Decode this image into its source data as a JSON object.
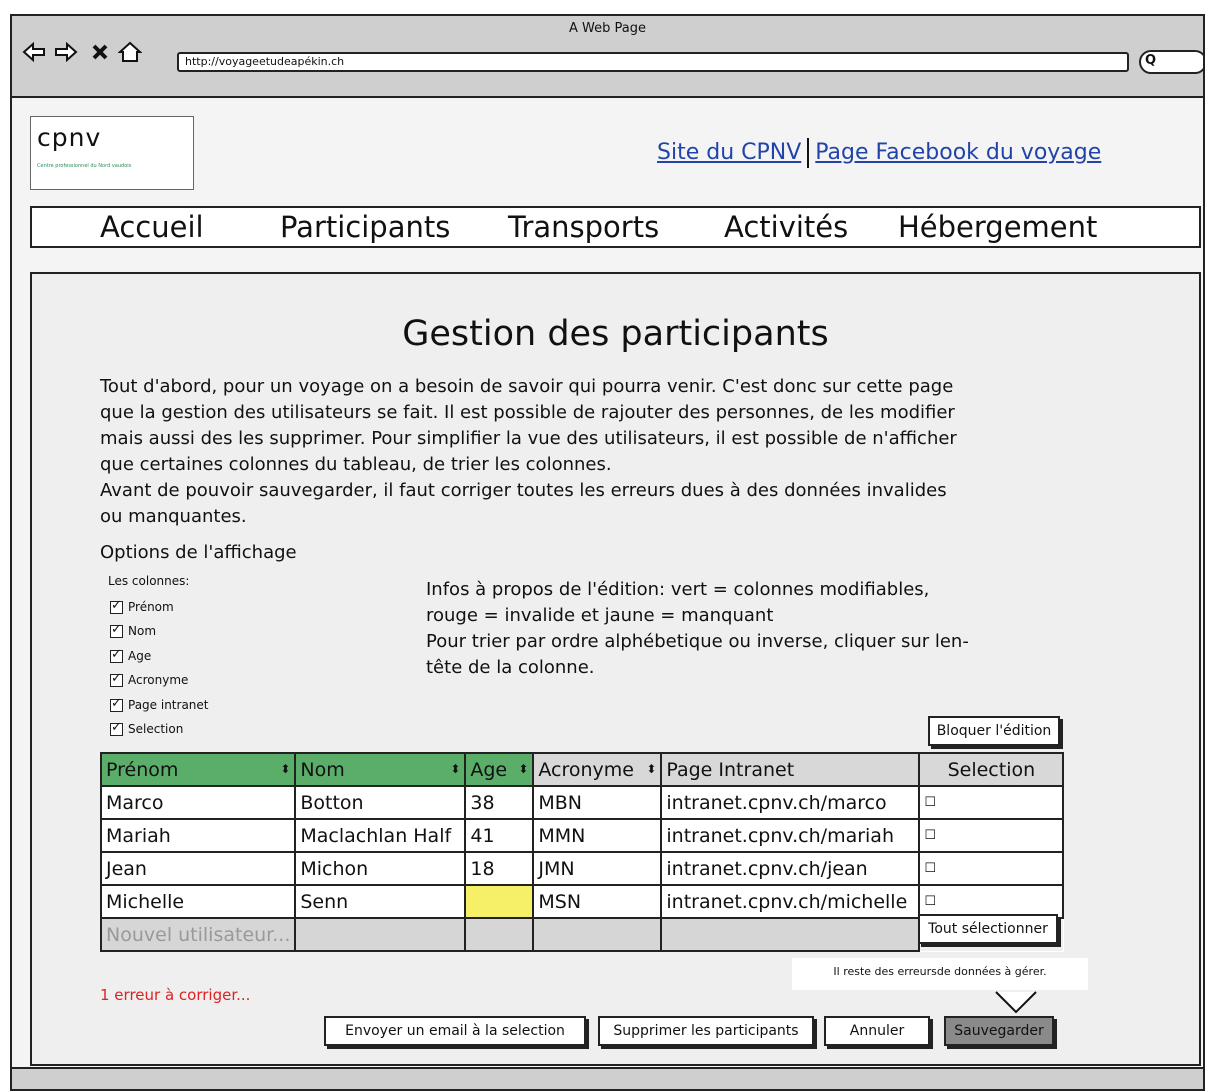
{
  "window": {
    "title": "A Web Page",
    "url": "http://voyageetudeapékin.ch"
  },
  "header": {
    "logo_text": "cpnv",
    "logo_subtitle": "Centre professionnel du Nord vaudois",
    "links": [
      "Site du CPNV",
      "Page Facebook du voyage"
    ]
  },
  "menu": [
    "Accueil",
    "Participants",
    "Transports",
    "Activités",
    "Hébergement"
  ],
  "main": {
    "title": "Gestion des participants",
    "intro": [
      "Tout d'abord, pour un voyage on a besoin de savoir qui pourra venir. C'est donc sur cette page",
      "que la gestion des utilisateurs se fait. Il est possible de rajouter des personnes, de les modifier",
      "mais aussi des les supprimer. Pour simplifier la vue des utilisateurs, il est possible de n'afficher",
      "que certaines colonnes du tableau, de trier les colonnes.",
      "Avant de pouvoir sauvegarder, il faut corriger toutes les erreurs dues à des données invalides",
      "ou manquantes."
    ],
    "options_title": "Options de l'affichage",
    "columns_label": "Les colonnes:",
    "column_options": [
      "Prénom",
      "Nom",
      "Age",
      "Acronyme",
      "Page intranet",
      "Selection"
    ],
    "infos": [
      "Infos à propos de l'édition: vert = colonnes modifiables,",
      "rouge = invalide et jaune = manquant",
      "Pour trier par ordre alphébetique ou inverse, cliquer sur len-",
      "tête de la colonne."
    ],
    "lock_button": "Bloquer l'édition",
    "table": {
      "headers": [
        "Prénom",
        "Nom",
        "Age",
        "Acronyme",
        "Page Intranet",
        "Selection"
      ],
      "rows": [
        [
          "Marco",
          "Botton",
          "38",
          "MBN",
          "intranet.cpnv.ch/marco"
        ],
        [
          "Mariah",
          "Maclachlan Half",
          "41",
          "MMN",
          "intranet.cpnv.ch/mariah"
        ],
        [
          "Jean",
          "Michon",
          "18",
          "JMN",
          "intranet.cpnv.ch/jean"
        ],
        [
          "Michelle",
          "Senn",
          "",
          "MSN",
          "intranet.cpnv.ch/michelle"
        ]
      ],
      "new_user_placeholder": "Nouvel utilisateur...",
      "select_all_button": "Tout sélectionner",
      "checkbox_glyph": "☐",
      "sort_glyph": "⬍"
    },
    "error_text": "1 erreur à corriger...",
    "tooltip": "Il reste des erreursde données à gérer.",
    "buttons": {
      "email": "Envoyer un email à la selection",
      "delete": "Supprimer les participants",
      "cancel": "Annuler",
      "save": "Sauvegarder"
    }
  },
  "colors": {
    "editable": "#5aae6a",
    "missing": "#f5f068",
    "error": "#d22222",
    "link": "#2244aa"
  }
}
